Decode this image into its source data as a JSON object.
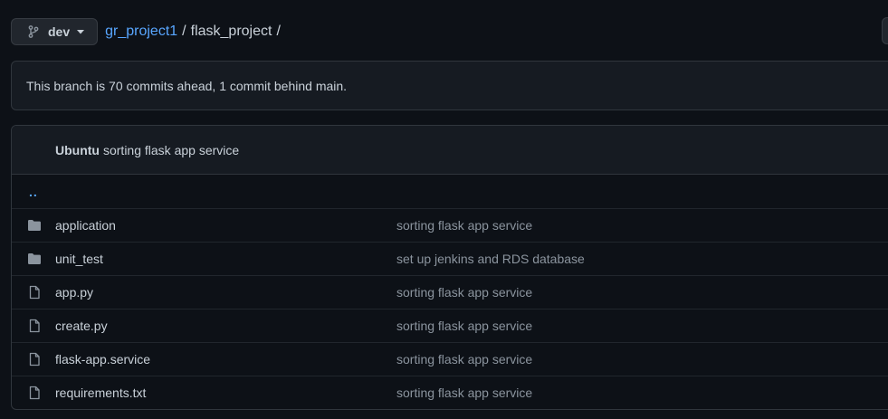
{
  "branch": {
    "name": "dev",
    "icon": "git-branch-icon"
  },
  "breadcrumb": {
    "repo": "gr_project1",
    "separator": "/",
    "folder": "flask_project",
    "trailing_separator": "/"
  },
  "notice": {
    "text": "This branch is 70 commits ahead, 1 commit behind main."
  },
  "latest_commit": {
    "author": "Ubuntu",
    "message": "sorting flask app service"
  },
  "parent_dir": {
    "label": ".."
  },
  "files": [
    {
      "type": "folder",
      "name": "application",
      "commit": "sorting flask app service"
    },
    {
      "type": "folder",
      "name": "unit_test",
      "commit": "set up jenkins and RDS database"
    },
    {
      "type": "file",
      "name": "app.py",
      "commit": "sorting flask app service"
    },
    {
      "type": "file",
      "name": "create.py",
      "commit": "sorting flask app service"
    },
    {
      "type": "file",
      "name": "flask-app.service",
      "commit": "sorting flask app service"
    },
    {
      "type": "file",
      "name": "requirements.txt",
      "commit": "sorting flask app service"
    }
  ],
  "colors": {
    "background": "#0d1117",
    "link": "#58a6ff",
    "text": "#c9d1d9",
    "muted": "#8b949e",
    "icon": "#8b949e"
  }
}
